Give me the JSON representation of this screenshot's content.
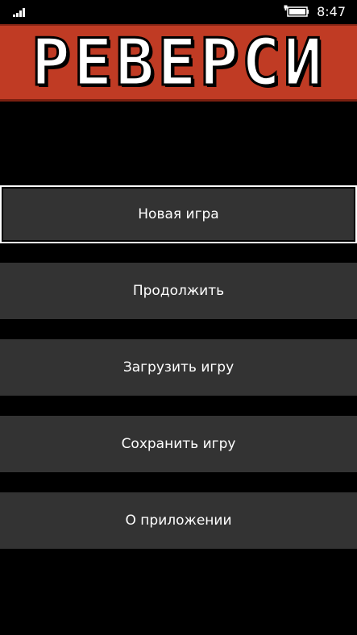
{
  "status_bar": {
    "time": "8:47",
    "signal_icon": "signal-bars-icon",
    "battery_icon": "battery-charging-icon"
  },
  "banner": {
    "title": "РЕВЕРСИ",
    "color": "#c03b24"
  },
  "menu": {
    "items": [
      {
        "label": "Новая игра",
        "selected": true
      },
      {
        "label": "Продолжить",
        "selected": false
      },
      {
        "label": "Загрузить игру",
        "selected": false
      },
      {
        "label": "Сохранить игру",
        "selected": false
      },
      {
        "label": "О приложении",
        "selected": false
      }
    ]
  },
  "colors": {
    "background": "#000000",
    "button": "#333333",
    "text": "#ffffff"
  }
}
